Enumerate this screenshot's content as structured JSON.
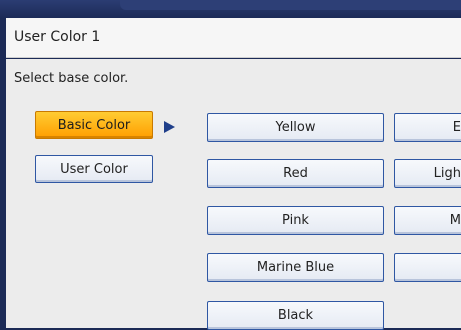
{
  "window": {
    "title": "User Color 1"
  },
  "instruction": "Select base color.",
  "mode_buttons": [
    {
      "label": "Basic Color",
      "selected": true
    },
    {
      "label": "User Color",
      "selected": false
    }
  ],
  "color_options": [
    {
      "label": "Yellow"
    },
    {
      "label": "Red"
    },
    {
      "label": "Pink"
    },
    {
      "label": "Marine Blue"
    },
    {
      "label": "Black"
    }
  ],
  "clipped_column": [
    {
      "label": "E"
    },
    {
      "label": "Ligh"
    },
    {
      "label": "M"
    },
    {
      "label": ""
    }
  ],
  "colors": {
    "selected_button": "#ff9e00",
    "button_border": "#2f57a3",
    "arrow": "#1f3f8a"
  }
}
